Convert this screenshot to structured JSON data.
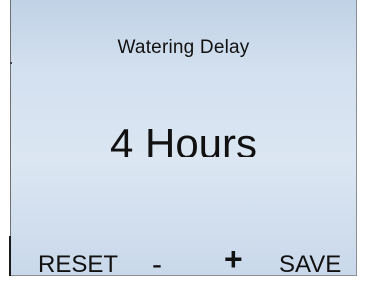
{
  "screen": {
    "title": "Watering Delay",
    "value": "4 Hours"
  },
  "softkeys": {
    "reset": "RESET",
    "minus": "-",
    "plus": "+",
    "save": "SAVE"
  }
}
